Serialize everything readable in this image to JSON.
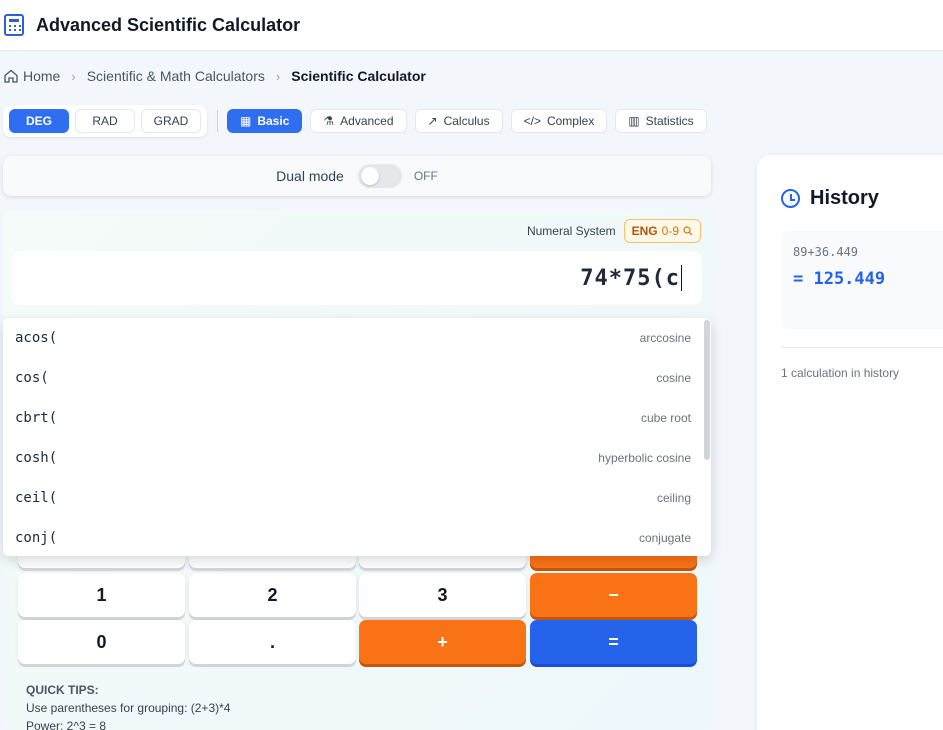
{
  "header": {
    "title": "Advanced Scientific Calculator",
    "icon": "calculator-icon"
  },
  "breadcrumb": {
    "home": "Home",
    "category": "Scientific & Math Calculators",
    "current": "Scientific Calculator"
  },
  "angle_modes": [
    "DEG",
    "RAD",
    "GRAD"
  ],
  "angle_selected": "DEG",
  "modes": [
    {
      "label": "Basic",
      "icon": "calculator-icon",
      "glyph": "▦"
    },
    {
      "label": "Advanced",
      "icon": "flask-icon",
      "glyph": "⚗"
    },
    {
      "label": "Calculus",
      "icon": "trend-icon",
      "glyph": "↗"
    },
    {
      "label": "Complex",
      "icon": "code-icon",
      "glyph": "</>"
    },
    {
      "label": "Statistics",
      "icon": "bar-chart-icon",
      "glyph": "▥"
    }
  ],
  "mode_selected": "Basic",
  "dual_mode": {
    "label": "Dual mode",
    "state": "OFF"
  },
  "numeral": {
    "label": "Numeral System",
    "code": "ENG",
    "digits": "0-9"
  },
  "display": {
    "expression": "74*75(c"
  },
  "suggestions": [
    {
      "fn": "acos(",
      "desc": "arccosine"
    },
    {
      "fn": "cos(",
      "desc": "cosine"
    },
    {
      "fn": "cbrt(",
      "desc": "cube root"
    },
    {
      "fn": "cosh(",
      "desc": "hyperbolic cosine"
    },
    {
      "fn": "ceil(",
      "desc": "ceiling"
    },
    {
      "fn": "conj(",
      "desc": "conjugate"
    }
  ],
  "keys": {
    "one": "1",
    "two": "2",
    "three": "3",
    "minus": "−",
    "zero": "0",
    "dot": ".",
    "plus": "+",
    "equals": "="
  },
  "tips": {
    "title": "QUICK TIPS:",
    "lines": [
      "Use parentheses for grouping: (2+3)*4",
      "Power: 2^3 = 8"
    ]
  },
  "history": {
    "title": "History",
    "entries": [
      {
        "expr": "89+36.449",
        "result": "= 125.449"
      }
    ],
    "count_text": "1 calculation in history"
  },
  "colors": {
    "accent": "#2f6ef0",
    "operator": "#f97316",
    "equals": "#2563eb",
    "badge": "#b45309"
  }
}
